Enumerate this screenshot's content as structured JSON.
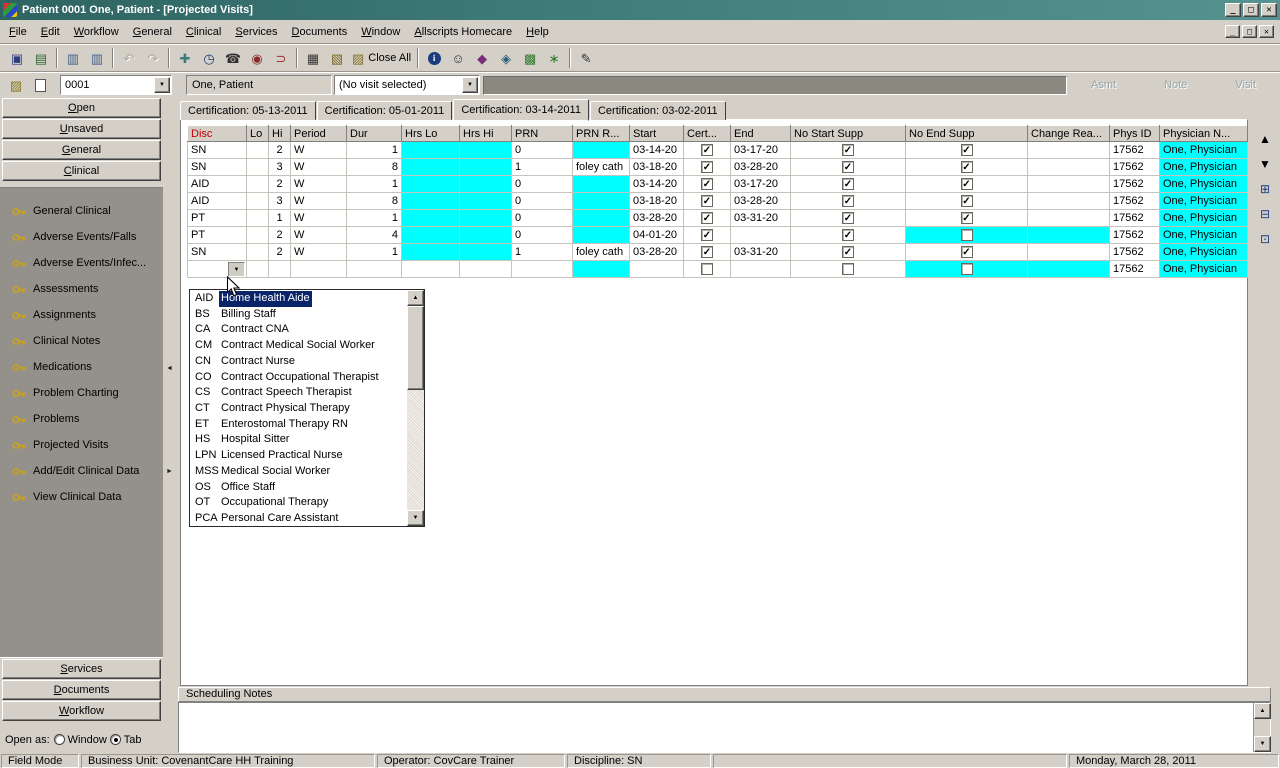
{
  "window": {
    "title": "Patient 0001 One, Patient - [Projected Visits]",
    "controls": {
      "minimize": "_",
      "maximize": "□",
      "close": "✕"
    }
  },
  "menu": {
    "items": [
      "File",
      "Edit",
      "Workflow",
      "General",
      "Clinical",
      "Services",
      "Documents",
      "Window",
      "Allscripts Homecare",
      "Help"
    ]
  },
  "toolbar_main": {
    "close_all_label": "Close All",
    "icons": [
      {
        "name": "save-icon",
        "glyph": "▣",
        "color": "#2b3f7e"
      },
      {
        "name": "patient-chart-icon",
        "glyph": "▤",
        "color": "#2e6b2e"
      },
      {
        "sep": true
      },
      {
        "name": "copy-visit-icon",
        "glyph": "▥",
        "color": "#44608a"
      },
      {
        "name": "send-visit-icon",
        "glyph": "▥",
        "color": "#44608a"
      },
      {
        "sep": true
      },
      {
        "name": "undo-icon",
        "glyph": "↶",
        "color": "#555555",
        "disabled": true
      },
      {
        "name": "redo-icon",
        "glyph": "↷",
        "color": "#555555",
        "disabled": true
      },
      {
        "sep": true
      },
      {
        "name": "syringe-icon",
        "glyph": "✚",
        "color": "#3a7d7d"
      },
      {
        "name": "clock-icon",
        "glyph": "◷",
        "color": "#1b3c7e"
      },
      {
        "name": "phone-icon",
        "glyph": "☎",
        "color": "#333333"
      },
      {
        "name": "record-icon",
        "glyph": "◉",
        "color": "#8a2b2b"
      },
      {
        "name": "magnet-icon",
        "glyph": "⊃",
        "color": "#a03030"
      },
      {
        "sep": true
      },
      {
        "name": "columns-icon",
        "glyph": "▦",
        "color": "#333333"
      },
      {
        "name": "folder-icon",
        "glyph": "▧",
        "color": "#7a6a2a"
      },
      {
        "close_all": true
      },
      {
        "sep": true
      },
      {
        "name": "info-icon",
        "glyph": "i",
        "color": "#ffffff",
        "cls": "circle-blue"
      },
      {
        "name": "user-icon",
        "glyph": "☺",
        "color": "#333333"
      },
      {
        "name": "shield-icon",
        "glyph": "◆",
        "color": "#7a2b7a"
      },
      {
        "name": "diamond-icon",
        "glyph": "◈",
        "color": "#2b5f7a"
      },
      {
        "name": "tiles-icon",
        "glyph": "▩",
        "color": "#2e7d2e"
      },
      {
        "name": "burst-icon",
        "glyph": "∗",
        "color": "#2e7d2e"
      },
      {
        "sep": true
      },
      {
        "name": "signature-icon",
        "glyph": "✎",
        "color": "#333333"
      }
    ]
  },
  "toolbar_patient": {
    "icons": [
      {
        "name": "open-folder-icon",
        "glyph": "▨",
        "color": "#8a7a22"
      },
      {
        "name": "new-document-icon",
        "glyph": " ",
        "color": "#445566",
        "cls": "doc-white"
      }
    ],
    "patient_id": "0001",
    "patient_name": "One, Patient",
    "visit_value": "(No visit selected)",
    "actions": [
      "Asmt",
      "Note",
      "Visit"
    ]
  },
  "sidebar": {
    "top_buttons": [
      "Open",
      "Unsaved",
      "General",
      "Clinical"
    ],
    "clinical_items": [
      "General Clinical",
      "Adverse Events/Falls",
      "Adverse Events/Infec...",
      "Assessments",
      "Assignments",
      "Clinical Notes",
      "Medications",
      "Problem Charting",
      "Problems",
      "Projected Visits",
      "Add/Edit Clinical Data",
      "View Clinical Data"
    ],
    "bottom_buttons": [
      "Services",
      "Documents",
      "Workflow"
    ],
    "open_as_label": "Open as:",
    "open_as_options": [
      {
        "label": "Window",
        "selected": false
      },
      {
        "label": "Tab",
        "selected": true
      }
    ]
  },
  "tabs": [
    {
      "label": "Certification: 05-13-2011",
      "active": false
    },
    {
      "label": "Certification: 05-01-2011",
      "active": false
    },
    {
      "label": "Certification: 03-14-2011",
      "active": true
    },
    {
      "label": "Certification: 03-02-2011",
      "active": false
    }
  ],
  "grid": {
    "columns": [
      {
        "key": "disc",
        "label": "Disc"
      },
      {
        "key": "lo",
        "label": "Lo"
      },
      {
        "key": "hi",
        "label": "Hi"
      },
      {
        "key": "period",
        "label": "Period"
      },
      {
        "key": "dur",
        "label": "Dur"
      },
      {
        "key": "hrs_lo",
        "label": "Hrs Lo"
      },
      {
        "key": "hrs_hi",
        "label": "Hrs Hi"
      },
      {
        "key": "prn",
        "label": "PRN"
      },
      {
        "key": "prn_r",
        "label": "PRN R..."
      },
      {
        "key": "start",
        "label": "Start"
      },
      {
        "key": "cert",
        "label": "Cert..."
      },
      {
        "key": "end",
        "label": "End"
      },
      {
        "key": "no_start",
        "label": "No Start Supp"
      },
      {
        "key": "no_end",
        "label": "No End Supp"
      },
      {
        "key": "change_rea",
        "label": "Change Rea..."
      },
      {
        "key": "phys_id",
        "label": "Phys ID"
      },
      {
        "key": "physician",
        "label": "Physician N..."
      }
    ],
    "rows": [
      {
        "disc": "SN",
        "lo": "",
        "hi": "2",
        "period": "W",
        "dur": "1",
        "hrs_lo": "",
        "hrs_hi": "",
        "prn": "0",
        "prn_r": "",
        "start": "03-14-20",
        "cert": "on",
        "end": "03-17-20",
        "no_start": "on",
        "no_end": "on",
        "change_rea": "",
        "phys_id": "17562",
        "physician": "One, Physician",
        "cyan": [
          "hrs_lo",
          "hrs_hi",
          "prn_r",
          "physician"
        ]
      },
      {
        "disc": "SN",
        "lo": "",
        "hi": "3",
        "period": "W",
        "dur": "8",
        "hrs_lo": "",
        "hrs_hi": "",
        "prn": "1",
        "prn_r": "foley cath",
        "start": "03-18-20",
        "cert": "on",
        "end": "03-28-20",
        "no_start": "on",
        "no_end": "on",
        "change_rea": "",
        "phys_id": "17562",
        "physician": "One, Physician",
        "cyan": [
          "hrs_lo",
          "hrs_hi",
          "physician"
        ]
      },
      {
        "disc": "AID",
        "lo": "",
        "hi": "2",
        "period": "W",
        "dur": "1",
        "hrs_lo": "",
        "hrs_hi": "",
        "prn": "0",
        "prn_r": "",
        "start": "03-14-20",
        "cert": "on",
        "end": "03-17-20",
        "no_start": "on",
        "no_end": "on",
        "change_rea": "",
        "phys_id": "17562",
        "physician": "One, Physician",
        "cyan": [
          "hrs_lo",
          "hrs_hi",
          "prn_r",
          "physician"
        ]
      },
      {
        "disc": "AID",
        "lo": "",
        "hi": "3",
        "period": "W",
        "dur": "8",
        "hrs_lo": "",
        "hrs_hi": "",
        "prn": "0",
        "prn_r": "",
        "start": "03-18-20",
        "cert": "on",
        "end": "03-28-20",
        "no_start": "on",
        "no_end": "on",
        "change_rea": "",
        "phys_id": "17562",
        "physician": "One, Physician",
        "cyan": [
          "hrs_lo",
          "hrs_hi",
          "prn_r",
          "physician"
        ]
      },
      {
        "disc": "PT",
        "lo": "",
        "hi": "1",
        "period": "W",
        "dur": "1",
        "hrs_lo": "",
        "hrs_hi": "",
        "prn": "0",
        "prn_r": "",
        "start": "03-28-20",
        "cert": "on",
        "end": "03-31-20",
        "no_start": "on",
        "no_end": "on",
        "change_rea": "",
        "phys_id": "17562",
        "physician": "One, Physician",
        "cyan": [
          "hrs_lo",
          "hrs_hi",
          "prn_r",
          "physician"
        ]
      },
      {
        "disc": "PT",
        "lo": "",
        "hi": "2",
        "period": "W",
        "dur": "4",
        "hrs_lo": "",
        "hrs_hi": "",
        "prn": "0",
        "prn_r": "",
        "start": "04-01-20",
        "cert": "on",
        "end": "",
        "no_start": "on",
        "no_end": "off",
        "change_rea": "",
        "phys_id": "17562",
        "physician": "One, Physician",
        "cyan": [
          "hrs_lo",
          "hrs_hi",
          "prn_r",
          "no_end",
          "change_rea",
          "physician"
        ]
      },
      {
        "disc": "SN",
        "lo": "",
        "hi": "2",
        "period": "W",
        "dur": "1",
        "hrs_lo": "",
        "hrs_hi": "",
        "prn": "1",
        "prn_r": "foley cath",
        "start": "03-28-20",
        "cert": "on",
        "end": "03-31-20",
        "no_start": "on",
        "no_end": "on",
        "change_rea": "",
        "phys_id": "17562",
        "physician": "One, Physician",
        "cyan": [
          "hrs_lo",
          "hrs_hi",
          "physician"
        ]
      },
      {
        "disc": "",
        "lo": "",
        "hi": "",
        "period": "",
        "dur": "",
        "hrs_lo": "",
        "hrs_hi": "",
        "prn": "",
        "prn_r": "",
        "start": "",
        "cert": "off",
        "end": "",
        "no_start": "off",
        "no_end": "off",
        "change_rea": "",
        "phys_id": "17562",
        "physician": "One, Physician",
        "cyan": [
          "prn_r",
          "no_end",
          "change_rea",
          "physician"
        ],
        "editing": true
      }
    ]
  },
  "disc_dropdown": {
    "highlighted_index": 0,
    "items": [
      {
        "code": "AID",
        "desc": "Home Health Aide"
      },
      {
        "code": "BS",
        "desc": "Billing Staff"
      },
      {
        "code": "CA",
        "desc": "Contract CNA"
      },
      {
        "code": "CM",
        "desc": "Contract Medical Social Worker"
      },
      {
        "code": "CN",
        "desc": "Contract Nurse"
      },
      {
        "code": "CO",
        "desc": "Contract Occupational Therapist"
      },
      {
        "code": "CS",
        "desc": "Contract Speech Therapist"
      },
      {
        "code": "CT",
        "desc": "Contract Physical Therapy"
      },
      {
        "code": "ET",
        "desc": "Enterostomal Therapy RN"
      },
      {
        "code": "HS",
        "desc": "Hospital Sitter"
      },
      {
        "code": "LPN",
        "desc": "Licensed Practical Nurse"
      },
      {
        "code": "MSS",
        "desc": "Medical Social Worker"
      },
      {
        "code": "OS",
        "desc": "Office Staff"
      },
      {
        "code": "OT",
        "desc": "Occupational Therapy"
      },
      {
        "code": "PCA",
        "desc": "Personal Care Assistant"
      }
    ]
  },
  "grid_tools": [
    {
      "name": "scroll-up-icon",
      "glyph": "▲",
      "color": "#000000"
    },
    {
      "name": "scroll-down-icon",
      "glyph": "▼",
      "color": "#000000"
    },
    {
      "name": "insert-row-icon",
      "glyph": "⊞",
      "color": "#1b3c7e"
    },
    {
      "name": "delete-row-icon",
      "glyph": "⊟",
      "color": "#1b3c7e"
    },
    {
      "name": "row-detail-icon",
      "glyph": "⊡",
      "color": "#1b3c7e"
    }
  ],
  "scheduling_notes": {
    "label": "Scheduling Notes",
    "value": ""
  },
  "statusbar": {
    "segments": [
      "Field Mode",
      "Business Unit: CovenantCare HH Training",
      "Operator: CovCare Trainer",
      "Discipline: SN",
      "",
      "Monday, March 28, 2011"
    ]
  },
  "colors": {
    "required_field": "#00ffff",
    "selection": "#0a246a",
    "titlebar": "#3a6c6b"
  }
}
